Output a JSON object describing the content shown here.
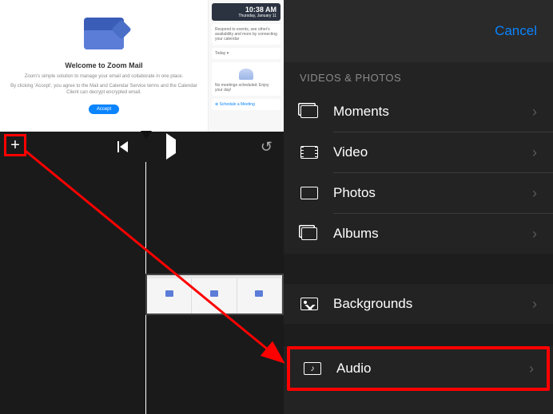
{
  "editor": {
    "preview": {
      "title": "Welcome to Zoom Mail",
      "subtitle1": "Zoom's simple solution to manage your email and collaborate in one place.",
      "subtitle2": "By clicking 'Accept', you agree to the Mail and Calendar Service terms and the Calendar Client can decrypt encrypted email.",
      "accept": "Accept",
      "sidebar": {
        "time": "10:38 AM",
        "date": "Thursday, January 11",
        "hint": "Respond to events, see other's availability and more by connecting your calendar",
        "today": "Today ▾",
        "empty": "No meetings scheduled. Enjoy your day!",
        "schedule": "⊕ Schedule a Meeting"
      }
    },
    "controls": {
      "add": "+",
      "skip_start": "",
      "play": "",
      "undo": "↺"
    }
  },
  "picker": {
    "cancel": "Cancel",
    "section1": "VIDEOS & PHOTOS",
    "rows": {
      "moments": "Moments",
      "video": "Video",
      "photos": "Photos",
      "albums": "Albums",
      "backgrounds": "Backgrounds",
      "audio": "Audio"
    }
  },
  "annotation": {
    "highlight_color": "#ff0000"
  }
}
